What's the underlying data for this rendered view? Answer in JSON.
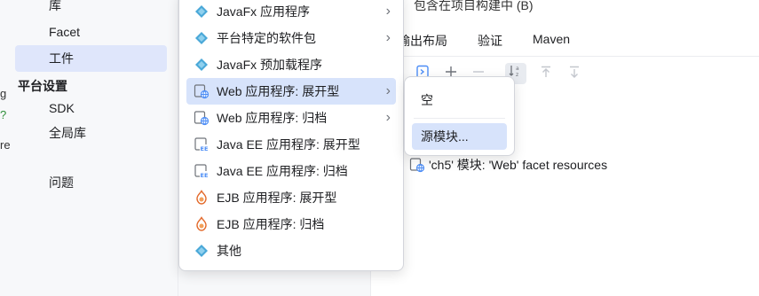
{
  "sidebar": {
    "items": [
      {
        "label": "库"
      },
      {
        "label": "Facet"
      },
      {
        "label": "工件"
      }
    ],
    "platform_header": "平台设置",
    "platform_items": [
      {
        "label": "SDK"
      },
      {
        "label": "全局库"
      }
    ],
    "problems": "问题",
    "edge_glyphs": [
      "g",
      "?",
      "re"
    ]
  },
  "main": {
    "top_text": "包含在项目构建中 (B)",
    "tabs": [
      "输出布局",
      "验证",
      "Maven"
    ],
    "tree_row": "'ch5' 模块: 'Web' facet resources"
  },
  "menu": {
    "items": [
      {
        "label": "JavaFx 应用程序",
        "icon": "diamond-icon",
        "submenu": true
      },
      {
        "label": "平台特定的软件包",
        "icon": "diamond-icon",
        "submenu": true
      },
      {
        "label": "JavaFx 预加载程序",
        "icon": "diamond-icon",
        "submenu": false
      },
      {
        "label": "Web 应用程序: 展开型",
        "icon": "web-globe-icon",
        "submenu": true
      },
      {
        "label": "Web 应用程序: 归档",
        "icon": "web-globe-icon",
        "submenu": true
      },
      {
        "label": "Java EE 应用程序: 展开型",
        "icon": "javaee-icon",
        "submenu": false
      },
      {
        "label": "Java EE 应用程序: 归档",
        "icon": "javaee-icon",
        "submenu": false
      },
      {
        "label": "EJB 应用程序: 展开型",
        "icon": "ejb-icon",
        "submenu": false
      },
      {
        "label": "EJB 应用程序: 归档",
        "icon": "ejb-icon",
        "submenu": false
      },
      {
        "label": "其他",
        "icon": "diamond-icon",
        "submenu": false
      }
    ]
  },
  "submenu": {
    "items": [
      {
        "label": "空"
      },
      {
        "label": "源模块..."
      }
    ]
  },
  "colors": {
    "selection": "#dfe6fb",
    "menu_highlight": "#d7e3fb",
    "accent": "#4c8df6"
  }
}
